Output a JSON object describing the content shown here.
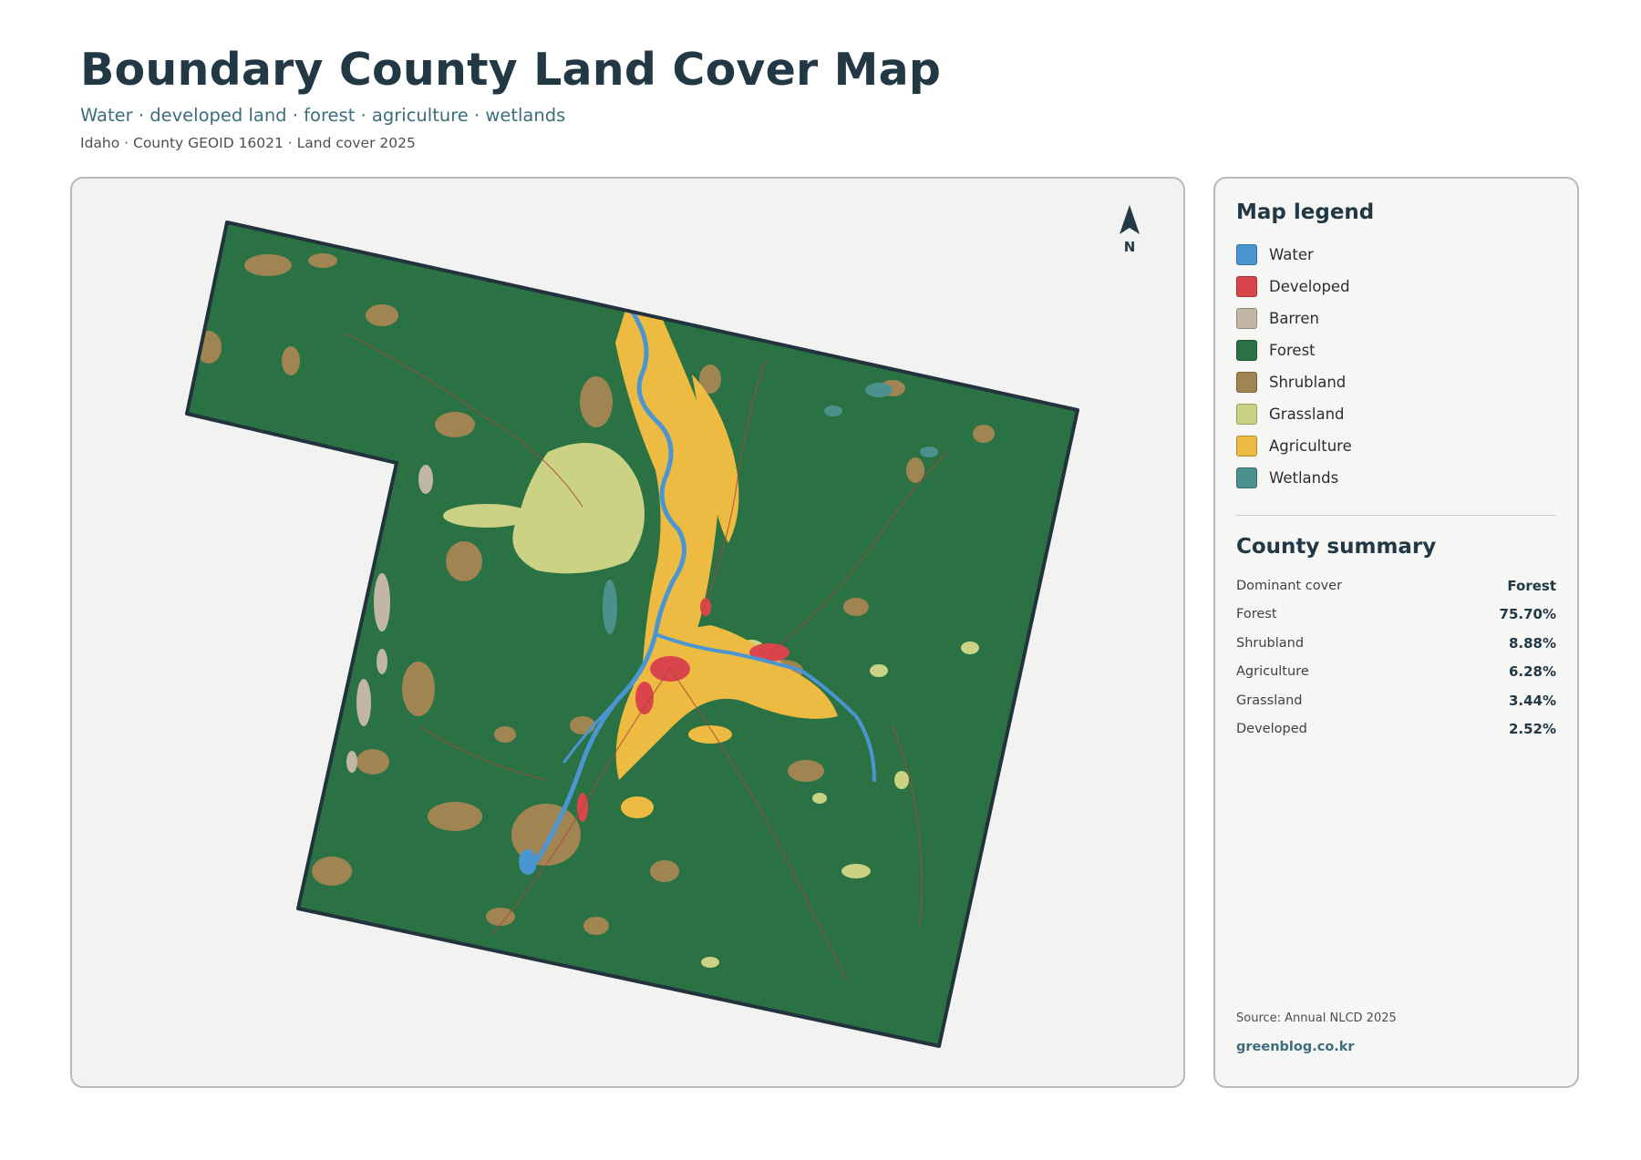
{
  "header": {
    "title": "Boundary County Land Cover Map",
    "subtitle": "Water · developed land · forest · agriculture · wetlands",
    "meta": "Idaho · County GEOID 16021 · Land cover 2025"
  },
  "map": {
    "north_label": "N",
    "colors": {
      "background": "#f2f2f1",
      "water": "#4b96d2",
      "developed": "#d9454a",
      "barren": "#c2b7a5",
      "forest": "#2a7244",
      "shrubland": "#a08452",
      "grassland": "#cbd283",
      "agriculture": "#edbb42",
      "wetlands": "#4b918d",
      "border": "#22333d"
    }
  },
  "legend": {
    "title": "Map legend",
    "items": [
      {
        "label": "Water",
        "color": "#4b96d2"
      },
      {
        "label": "Developed",
        "color": "#d9454a"
      },
      {
        "label": "Barren",
        "color": "#c2b7a5"
      },
      {
        "label": "Forest",
        "color": "#2a7244"
      },
      {
        "label": "Shrubland",
        "color": "#a08452"
      },
      {
        "label": "Grassland",
        "color": "#cbd283"
      },
      {
        "label": "Agriculture",
        "color": "#edbb42"
      },
      {
        "label": "Wetlands",
        "color": "#4b918d"
      }
    ]
  },
  "summary": {
    "title": "County summary",
    "rows": [
      {
        "key": "Dominant cover",
        "value": "Forest"
      },
      {
        "key": "Forest",
        "value": "75.70%"
      },
      {
        "key": "Shrubland",
        "value": "8.88%"
      },
      {
        "key": "Agriculture",
        "value": "6.28%"
      },
      {
        "key": "Grassland",
        "value": "3.44%"
      },
      {
        "key": "Developed",
        "value": "2.52%"
      }
    ]
  },
  "footer": {
    "source": "Source: Annual NLCD 2025",
    "credit": "greenblog.co.kr"
  }
}
